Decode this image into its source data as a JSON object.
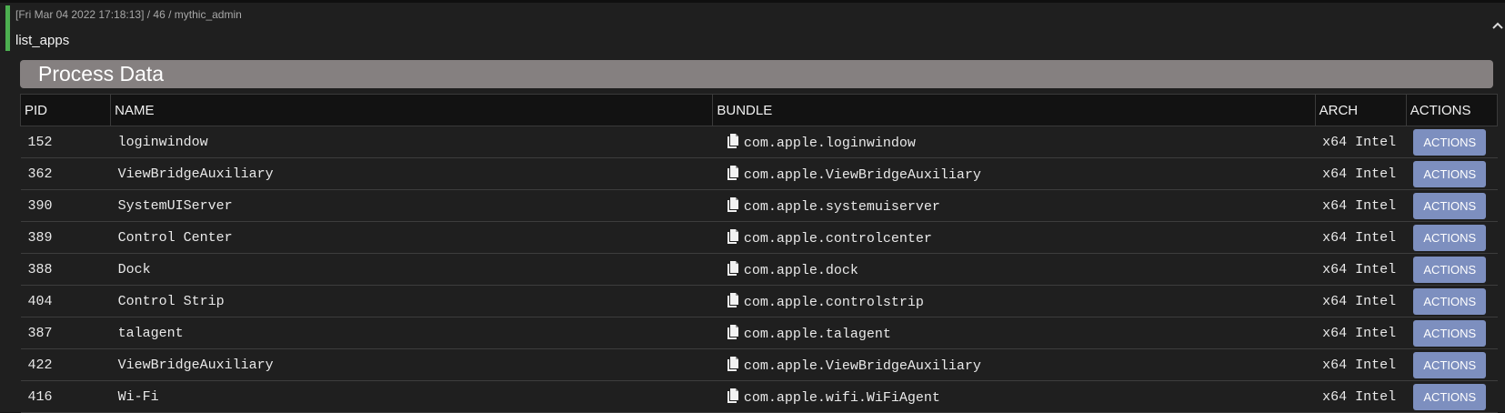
{
  "header": {
    "meta": "[Fri Mar 04 2022 17:18:13] / 46 / mythic_admin",
    "command": "list_apps"
  },
  "section_title": "Process Data",
  "table": {
    "columns": [
      "PID",
      "NAME",
      "BUNDLE",
      "ARCH",
      "ACTIONS"
    ],
    "action_label": "ACTIONS",
    "rows": [
      {
        "pid": "152",
        "name": "loginwindow",
        "bundle": "com.apple.loginwindow",
        "arch": "x64 Intel"
      },
      {
        "pid": "362",
        "name": "ViewBridgeAuxiliary",
        "bundle": "com.apple.ViewBridgeAuxiliary",
        "arch": "x64 Intel"
      },
      {
        "pid": "390",
        "name": "SystemUIServer",
        "bundle": "com.apple.systemuiserver",
        "arch": "x64 Intel"
      },
      {
        "pid": "389",
        "name": "Control Center",
        "bundle": "com.apple.controlcenter",
        "arch": "x64 Intel"
      },
      {
        "pid": "388",
        "name": "Dock",
        "bundle": "com.apple.dock",
        "arch": "x64 Intel"
      },
      {
        "pid": "404",
        "name": "Control Strip",
        "bundle": "com.apple.controlstrip",
        "arch": "x64 Intel"
      },
      {
        "pid": "387",
        "name": "talagent",
        "bundle": "com.apple.talagent",
        "arch": "x64 Intel"
      },
      {
        "pid": "422",
        "name": "ViewBridgeAuxiliary",
        "bundle": "com.apple.ViewBridgeAuxiliary",
        "arch": "x64 Intel"
      },
      {
        "pid": "416",
        "name": "Wi-Fi",
        "bundle": "com.apple.wifi.WiFiAgent",
        "arch": "x64 Intel"
      }
    ]
  },
  "icons": {
    "copy": "copy-icon",
    "collapse": "chevron-up-icon"
  },
  "colors": {
    "status_accent": "#4caf50",
    "title_bar": "#858080",
    "action_button": "#7d8fbf"
  }
}
